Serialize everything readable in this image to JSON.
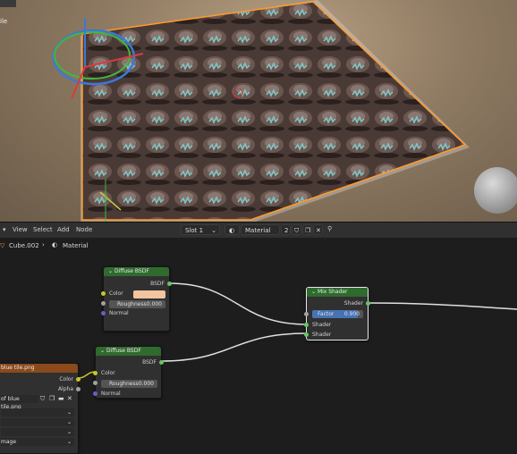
{
  "viewport": {
    "top_label": "ile"
  },
  "header": {
    "menu": [
      "View",
      "Select",
      "Add",
      "Node"
    ],
    "slot": "Slot 1",
    "material_name": "Material",
    "user_count": "2"
  },
  "breadcrumb": {
    "object": "Cube.002",
    "material": "Material"
  },
  "nodes": {
    "diffuse1": {
      "title": "Diffuse BSDF",
      "output": "BSDF",
      "color_label": "Color",
      "swatch": "#f2c4a0",
      "roughness": "Roughness",
      "roughness_value": "0.000",
      "normal": "Normal"
    },
    "diffuse2": {
      "title": "Diffuse BSDF",
      "output": "BSDF",
      "color_label": "Color",
      "roughness": "Roughness",
      "roughness_value": "0.000",
      "normal": "Normal"
    },
    "mix": {
      "title": "Mix Shader",
      "output": "Shader",
      "factor": "Factor",
      "factor_value": "0.900",
      "shader1": "Shader",
      "shader2": "Shader"
    },
    "image": {
      "title": "blue tile.png",
      "color": "Color",
      "alpha": "Alpha",
      "file": "of blue tile.png",
      "extra": "mage"
    }
  },
  "colors": {
    "node_header_green": "#2f6b2f",
    "node_header_orange": "#8a4a1c",
    "selection_outline": "#ff9b2a",
    "factor_blue": "#4772b3"
  }
}
